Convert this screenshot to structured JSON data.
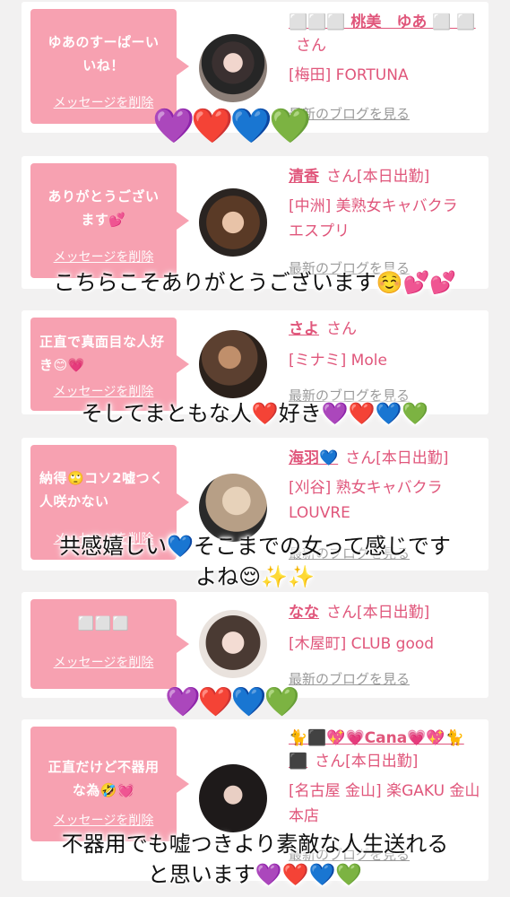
{
  "cards": [
    {
      "message": "ゆあのすーぱーいいね！",
      "delete": "メッセージを削除",
      "name": "⬜⬜⬜ 桃美　ゆあ ⬜ ⬜",
      "honorific": "さん",
      "status": "",
      "location": "[梅田] FORTUNA",
      "blog": "最新のブログを見る"
    },
    {
      "message": "ありがとうございます💕",
      "delete": "メッセージを削除",
      "name": "清香",
      "honorific": "さん",
      "status": "[本日出勤]",
      "location": "[中洲] 美熟女キャバクラ エスプリ",
      "blog": "最新のブログを見る"
    },
    {
      "message": "正直で真面目な人好き😊💗",
      "delete": "メッセージを削除",
      "name": "さよ",
      "honorific": "さん",
      "status": "",
      "location": "[ミナミ] Mole",
      "blog": "最新のブログを見る"
    },
    {
      "message": "納得🙄コソ2嘘つく人咲かない",
      "delete": "メッセージを削除",
      "name": "海羽💙",
      "honorific": "さん",
      "status": "[本日出勤]",
      "location": "[刈谷] 熟女キャバクラ LOUVRE",
      "blog": "最新のブログを見る"
    },
    {
      "message": "⬜⬜⬜",
      "delete": "メッセージを削除",
      "name": "なな",
      "honorific": "さん",
      "status": "[本日出勤]",
      "location": "[木屋町] CLUB good",
      "blog": "最新のブログを見る"
    },
    {
      "message": "正直だけど不器用な為🤣💓",
      "delete": "メッセージを削除",
      "name": "🐈⬛💖💗Cana💗💖🐈⬛",
      "honorific": "さん",
      "status": "[本日出勤]",
      "location": "[名古屋 金山] 楽GAKU 金山本店",
      "blog": "最新のブログを見る"
    }
  ],
  "captions": [
    "こちらこそありがとうございます☺️💕💕",
    "そしてまともな人❤️好き💜❤️💙💚",
    "共感嬉しい💙そこまでの女って感じです",
    "よね😌✨✨",
    "不器用でも嘘つきより素敵な人生送れる",
    "と思います💜❤️💙💚"
  ],
  "hearts": [
    "💜❤️💙💚",
    "💜❤️💙💚"
  ],
  "colors": {
    "bubble": "#f7a1b1",
    "accent": "#e0567b",
    "background": "#f2f1f1",
    "card": "#ffffff",
    "blog_link": "#9a9a9a"
  }
}
